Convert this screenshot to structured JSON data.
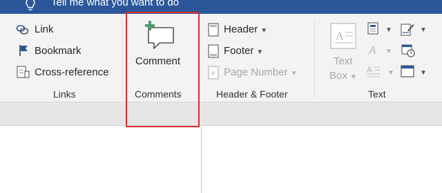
{
  "header": {
    "tell_me": "Tell me what you want to do",
    "lightbulb_icon": "lightbulb-icon"
  },
  "links_group": {
    "label": "Links",
    "items": [
      {
        "label": "Link",
        "icon": "link-icon"
      },
      {
        "label": "Bookmark",
        "icon": "bookmark-flag-icon"
      },
      {
        "label": "Cross-reference",
        "icon": "cross-reference-icon"
      }
    ]
  },
  "comments_group": {
    "label": "Comments",
    "comment_label": "Comment",
    "icon": "new-comment-icon"
  },
  "header_footer_group": {
    "label": "Header & Footer",
    "items": [
      {
        "label": "Header",
        "icon": "header-page-icon",
        "enabled": true
      },
      {
        "label": "Footer",
        "icon": "footer-page-icon",
        "enabled": true
      },
      {
        "label": "Page Number",
        "icon": "page-number-icon",
        "enabled": false
      }
    ]
  },
  "text_group": {
    "label": "Text",
    "textbox_line1": "Text",
    "textbox_line2": "Box",
    "icons": [
      "quick-parts-icon",
      "wordart-icon",
      "drop-cap-icon",
      "signature-line-icon",
      "date-time-icon",
      "object-icon"
    ]
  },
  "colors": {
    "titlebar": "#2b579a",
    "highlight": "#e02b2b",
    "ribbon": "#f3f3f3"
  }
}
